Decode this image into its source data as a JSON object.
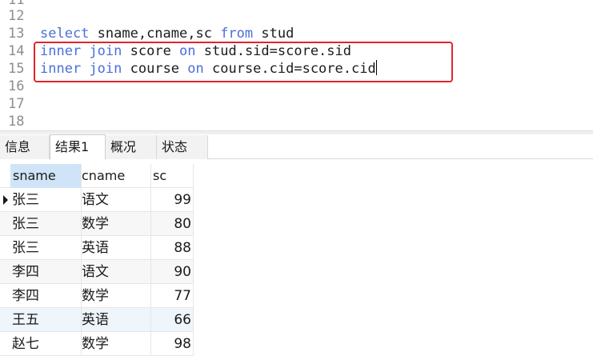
{
  "editor": {
    "lines": [
      {
        "num": "11",
        "tokens": []
      },
      {
        "num": "12",
        "tokens": []
      },
      {
        "num": "13",
        "tokens": [
          {
            "t": "select",
            "kw": true
          },
          {
            "t": " sname,cname,sc ",
            "kw": false
          },
          {
            "t": "from",
            "kw": true
          },
          {
            "t": " stud",
            "kw": false
          }
        ]
      },
      {
        "num": "14",
        "tokens": [
          {
            "t": "inner",
            "kw": true
          },
          {
            "t": " ",
            "kw": false
          },
          {
            "t": "join",
            "kw": true
          },
          {
            "t": " score ",
            "kw": false
          },
          {
            "t": "on",
            "kw": true
          },
          {
            "t": " stud.sid=score.sid",
            "kw": false
          }
        ]
      },
      {
        "num": "15",
        "tokens": [
          {
            "t": "inner",
            "kw": true
          },
          {
            "t": " ",
            "kw": false
          },
          {
            "t": "join",
            "kw": true
          },
          {
            "t": " course ",
            "kw": false
          },
          {
            "t": "on",
            "kw": true
          },
          {
            "t": " course.cid=score.cid",
            "kw": false
          }
        ],
        "caret": true
      },
      {
        "num": "16",
        "tokens": []
      },
      {
        "num": "17",
        "tokens": []
      },
      {
        "num": "18",
        "tokens": []
      }
    ],
    "colors": {
      "keyword": "#4a6fd8",
      "highlight_border": "#e2242b"
    }
  },
  "tabs": [
    {
      "label": "信息",
      "active": false
    },
    {
      "label": "结果1",
      "active": true
    },
    {
      "label": "概况",
      "active": false
    },
    {
      "label": "状态",
      "active": false
    }
  ],
  "grid": {
    "columns": [
      "sname",
      "cname",
      "sc"
    ],
    "rows": [
      [
        "张三",
        "语文",
        "99"
      ],
      [
        "张三",
        "数学",
        "80"
      ],
      [
        "张三",
        "英语",
        "88"
      ],
      [
        "李四",
        "语文",
        "90"
      ],
      [
        "李四",
        "数学",
        "77"
      ],
      [
        "王五",
        "英语",
        "66"
      ],
      [
        "赵七",
        "数学",
        "98"
      ]
    ]
  }
}
